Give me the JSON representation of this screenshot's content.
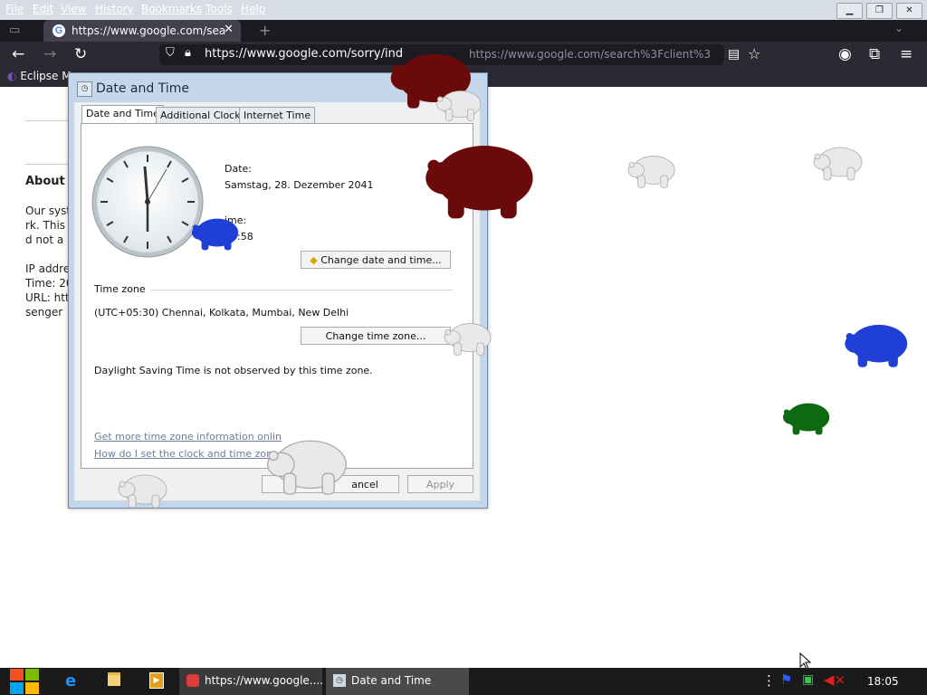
{
  "browser": {
    "menu": [
      "File",
      "Edit",
      "View",
      "History",
      "Bookmarks",
      "Tools",
      "Help"
    ],
    "tab_title": "https://www.google.com/searcl",
    "url_main": "https://www.google.com/sorry/ind",
    "url_tail": "https://www.google.com/search%3Fclient%3",
    "bookmark": "Eclipse M"
  },
  "page": {
    "heading": "About t",
    "lines": [
      "Our syst",
      "rk. This",
      "d not a r",
      "IP addre",
      "Time: 20",
      "URL: htt",
      "senger"
    ]
  },
  "dialog": {
    "title": "Date and Time",
    "tabs": [
      "Date and Time",
      "Additional Clocks",
      "Internet Time"
    ],
    "date_label": "Date:",
    "date_value": "Samstag, 28. Dezember 2041",
    "time_label": "ime:",
    "time_value": "05:58",
    "change_datetime": "Change date and time...",
    "tz_section": "Time zone",
    "tz_value": "(UTC+05:30) Chennai, Kolkata, Mumbai, New Delhi",
    "change_tz": "Change time zone...",
    "dst_note": "Daylight Saving Time is not observed by this time zone.",
    "link1": "Get more time zone information onlin",
    "link2": "How do I set the clock and time zon",
    "ok": "",
    "cancel": "ancel",
    "apply": "Apply"
  },
  "taskbar": {
    "task_browser": "https://www.google....",
    "task_dialog": "Date and Time",
    "clock": "18:05"
  },
  "colors": {
    "bear_white": "#e9e9ec",
    "bear_red": "#6b0a0a",
    "bear_blue": "#1f3fd6",
    "bear_green": "#0d6a12"
  }
}
